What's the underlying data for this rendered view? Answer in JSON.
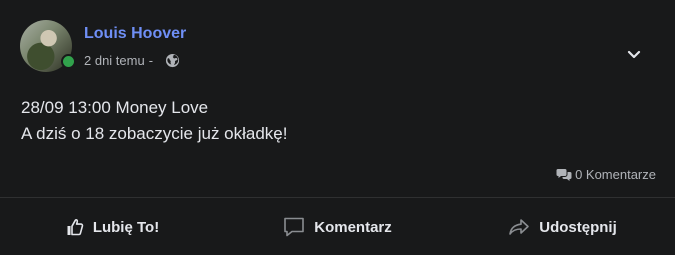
{
  "post": {
    "author": "Louis Hoover",
    "time": "2 dni temu",
    "separator": "-",
    "privacy_icon": "globe-icon",
    "menu_icon": "chevron-down-icon",
    "online_status_color": "#31a24c",
    "lines": [
      "28/09 13:00 Money Love",
      "A dziś o 18 zobaczycie już okładkę!"
    ],
    "comments_count": "0 Komentarze"
  },
  "actions": {
    "like": "Lubię To!",
    "comment": "Komentarz",
    "share": "Udostępnij"
  },
  "colors": {
    "background": "#18191a",
    "author_link": "#6f8ff6",
    "muted_text": "#b0b3b8"
  }
}
